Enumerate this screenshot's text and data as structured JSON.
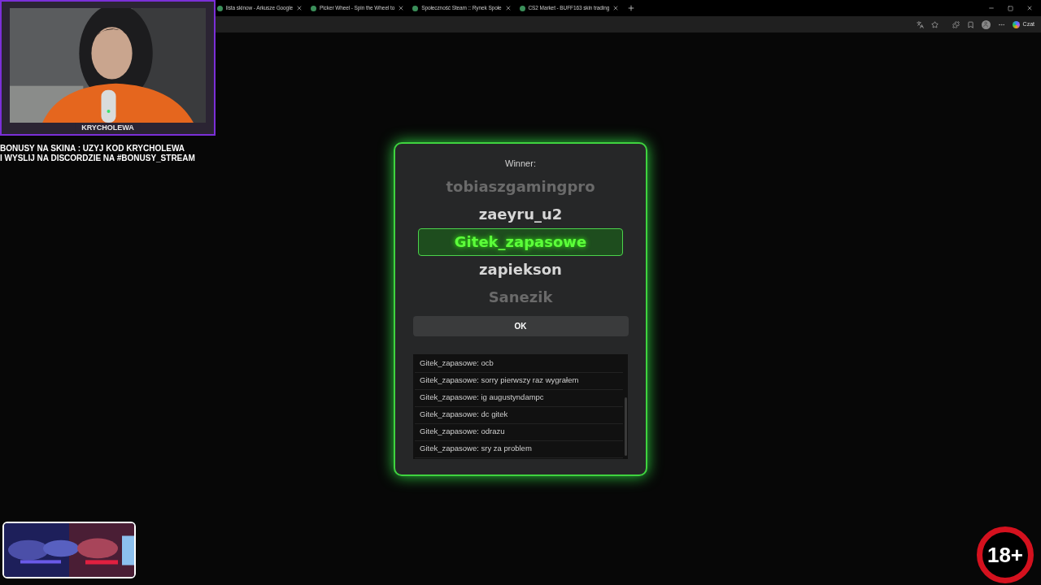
{
  "browser": {
    "tabs": [
      {
        "title": "lista skinow - Arkusze Google",
        "selected": false
      },
      {
        "title": "Picker Wheel - Spin the Wheel to",
        "selected": false
      },
      {
        "title": "Społeczność Steam :: Rynek Społe",
        "selected": false
      },
      {
        "title": "CS2 Market - BUFF163 skin trading",
        "selected": false
      }
    ],
    "chat_button": "Czat"
  },
  "winner_dialog": {
    "title": "Winner:",
    "names": [
      {
        "name": "tobiaszgamingpro",
        "selected": false
      },
      {
        "name": "zaeyru_u2",
        "selected": false
      },
      {
        "name": "Gitek_zapasowe",
        "selected": true
      },
      {
        "name": "zapiekson",
        "selected": false
      },
      {
        "name": "Sanezik",
        "selected": false
      }
    ],
    "ok_button": "OK",
    "chat": [
      "Gitek_zapasowe: ocb",
      "Gitek_zapasowe: sorry pierwszy raz wygrałem",
      "Gitek_zapasowe: ig augustyndampc",
      "Gitek_zapasowe: dc gitek",
      "Gitek_zapasowe: odrazu",
      "Gitek_zapasowe: sry za problem"
    ]
  },
  "stream_overlay": {
    "camera_label": "KRYCHOLEWA",
    "info_lines": [
      "BONUSY NA SKINA : UZYJ KOD KRYCHOLEWA",
      "I WYSLIJ NA DISCORDZIE NA #BONUSY_STREAM"
    ],
    "age_badge": "18+"
  }
}
